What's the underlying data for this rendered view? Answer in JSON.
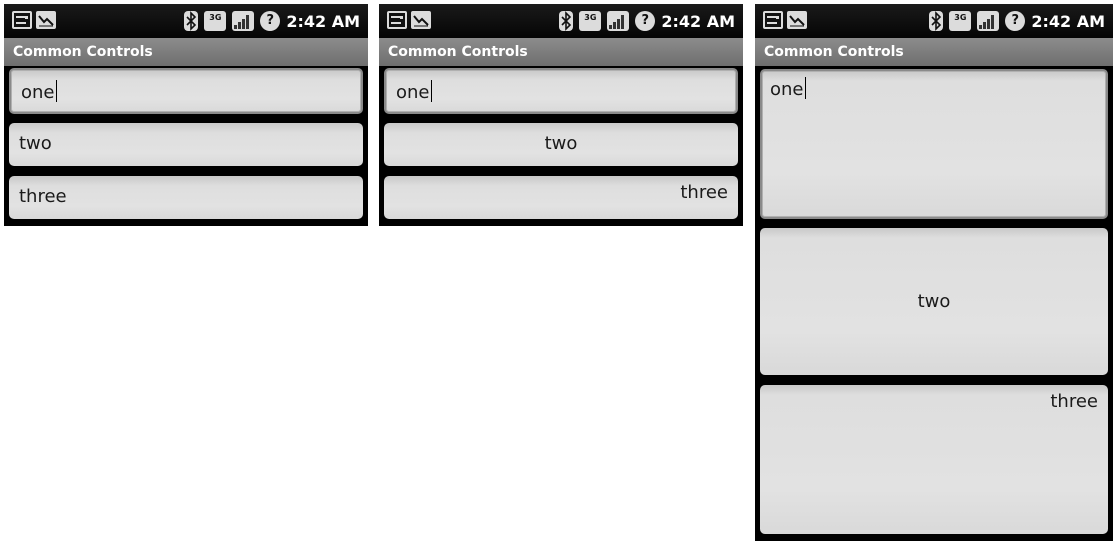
{
  "status_bar": {
    "time": "2:42 AM",
    "network_type": "3G",
    "battery_glyph": "?",
    "icons": [
      "notification-icon",
      "chart-icon",
      "bluetooth-icon",
      "network-3g-icon",
      "signal-icon",
      "battery-unknown-icon"
    ]
  },
  "screens": [
    {
      "title": "Common Controls",
      "fields": [
        {
          "value": "one",
          "align": "left",
          "focused": true
        },
        {
          "value": "two",
          "align": "left",
          "focused": false
        },
        {
          "value": "three",
          "align": "left",
          "focused": false
        }
      ]
    },
    {
      "title": "Common Controls",
      "fields": [
        {
          "value": "one",
          "align": "left",
          "focused": true
        },
        {
          "value": "two",
          "align": "center",
          "focused": false
        },
        {
          "value": "three",
          "align": "right",
          "focused": false
        }
      ]
    },
    {
      "title": "Common Controls",
      "fields": [
        {
          "value": "one",
          "align": "top-left",
          "focused": true
        },
        {
          "value": "two",
          "align": "center",
          "focused": false
        },
        {
          "value": "three",
          "align": "top-right",
          "focused": false
        }
      ]
    }
  ]
}
